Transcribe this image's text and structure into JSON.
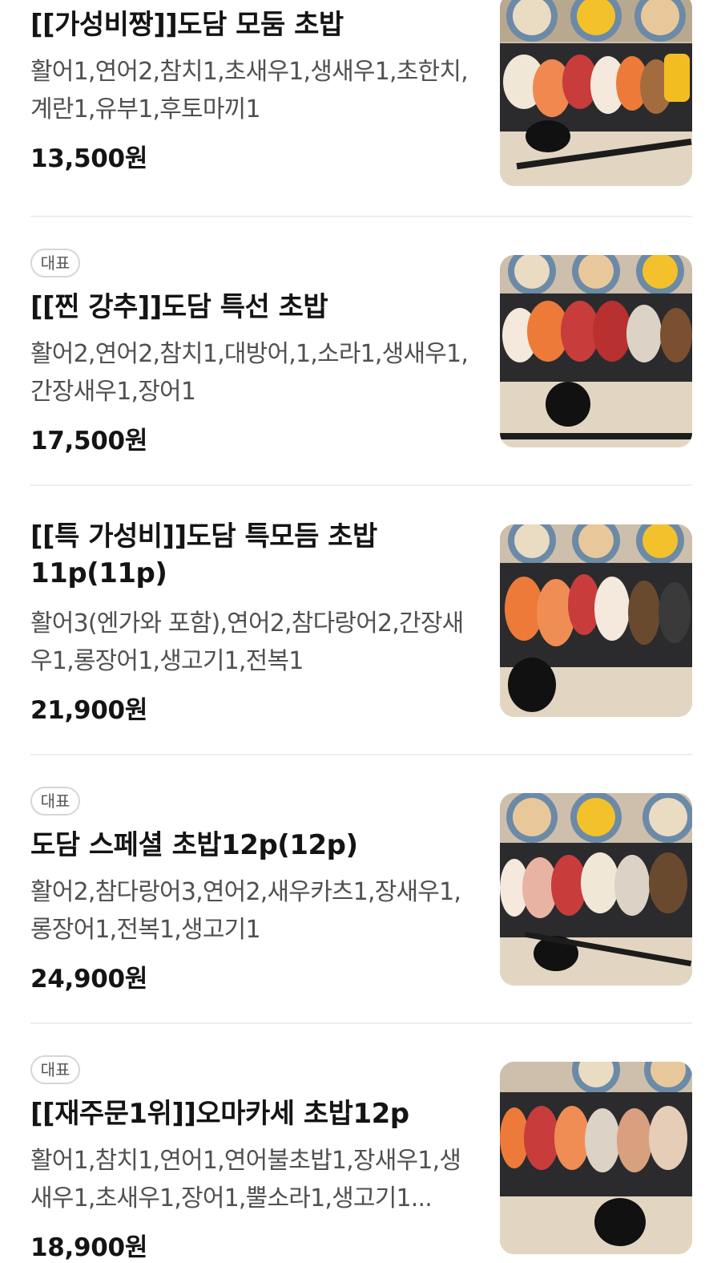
{
  "menu": {
    "currency_suffix": "원",
    "items": [
      {
        "badge": "",
        "title": "[[가성비짱]]도담 모둠 초밥",
        "description": "활어1,연어2,참치1,초새우1,생새우1,초한치,계란1,유부1,후토마끼1",
        "price": "13,500원",
        "image": "sushi-platter-photo"
      },
      {
        "badge": "대표",
        "title": "[[찐 강추]]도담 특선 초밥",
        "description": "활어2,연어2,참치1,대방어,1,소라1,생새우1,간장새우1,장어1",
        "price": "17,500원",
        "image": "sushi-platter-photo"
      },
      {
        "badge": "",
        "title": "[[특 가성비]]도담 특모듬 초밥 11p(11p)",
        "description": "활어3(엔가와 포함),연어2,참다랑어2,간장새우1,롱장어1,생고기1,전복1",
        "price": "21,900원",
        "image": "sushi-platter-photo"
      },
      {
        "badge": "대표",
        "title": "도담 스페셜 초밥12p(12p)",
        "description": "활어2,참다랑어3,연어2,새우카츠1,장새우1,롱장어1,전복1,생고기1",
        "price": "24,900원",
        "image": "sushi-platter-photo"
      },
      {
        "badge": "대표",
        "title": "[[재주문1위]]오마카세 초밥12p",
        "description": "활어1,참치1,연어1,연어불초밥1,장새우1,생새우1,초새우1,장어1,뿔소라1,생고기1...",
        "price": "18,900원",
        "image": "sushi-platter-photo"
      }
    ]
  },
  "colors": {
    "text_primary": "#141414",
    "text_secondary": "#505050",
    "divider": "#eeeeee",
    "badge_border": "#d6d6d6"
  }
}
